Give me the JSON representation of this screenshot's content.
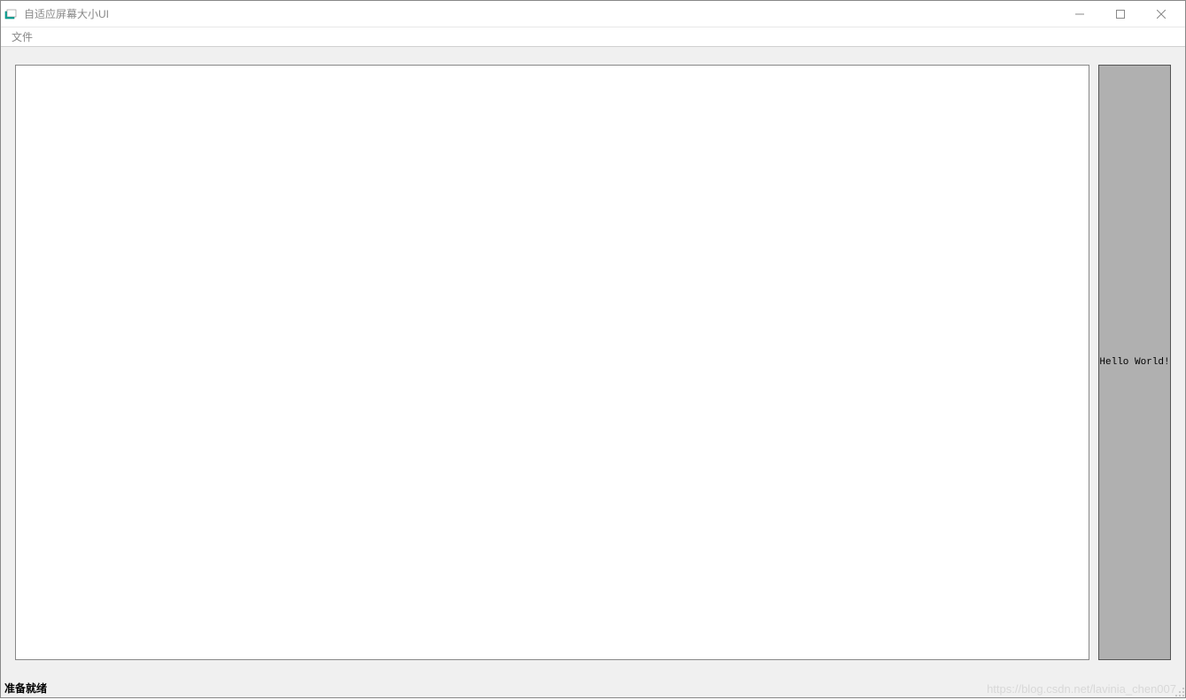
{
  "window": {
    "title": "自适应屏幕大小UI"
  },
  "menubar": {
    "items": [
      {
        "label": "文件"
      }
    ]
  },
  "main": {
    "button_label": "Hello World!"
  },
  "statusbar": {
    "text": "准备就绪"
  },
  "watermark": {
    "text": "https://blog.csdn.net/lavinia_chen007"
  }
}
